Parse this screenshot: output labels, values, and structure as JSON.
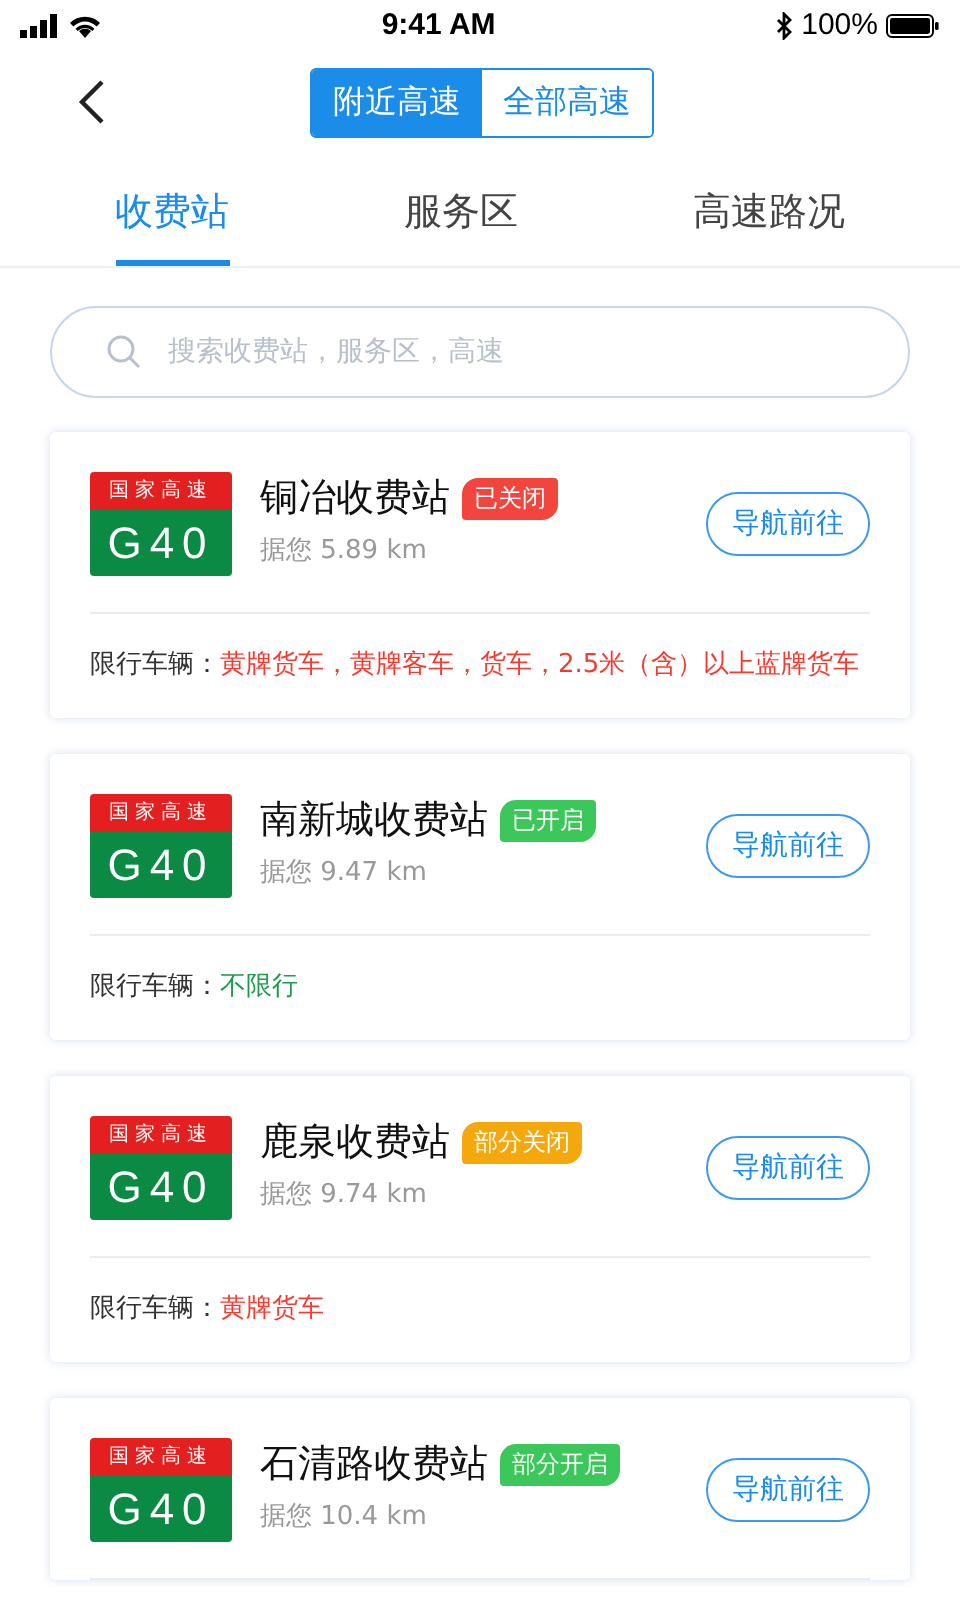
{
  "status_bar": {
    "time": "9:41 AM",
    "battery": "100%"
  },
  "segments": [
    {
      "label": "附近高速",
      "selected": true
    },
    {
      "label": "全部高速",
      "selected": false
    }
  ],
  "tabs": [
    {
      "label": "收费站",
      "selected": true
    },
    {
      "label": "服务区",
      "selected": false
    },
    {
      "label": "高速路况",
      "selected": false
    }
  ],
  "search": {
    "placeholder": "搜索收费站，服务区，高速"
  },
  "stations": [
    {
      "sign_top": "国家高速",
      "sign_code": "G40",
      "name": "铜冶收费站",
      "status": {
        "text": "已关闭",
        "color": "#f2453d"
      },
      "distance": "据您 5.89 km",
      "nav": "导航前往",
      "restriction": {
        "label": "限行车辆：",
        "text": "黄牌货车，黄牌客车，货车，2.5米（含）以上蓝牌货车",
        "color": "#f23c32"
      }
    },
    {
      "sign_top": "国家高速",
      "sign_code": "G40",
      "name": "南新城收费站",
      "status": {
        "text": "已开启",
        "color": "#3cc75a"
      },
      "distance": "据您 9.47 km",
      "nav": "导航前往",
      "restriction": {
        "label": "限行车辆：",
        "text": "不限行",
        "color": "#1f9a4e"
      }
    },
    {
      "sign_top": "国家高速",
      "sign_code": "G40",
      "name": "鹿泉收费站",
      "status": {
        "text": "部分关闭",
        "color": "#f5a80c"
      },
      "distance": "据您 9.74 km",
      "nav": "导航前往",
      "restriction": {
        "label": "限行车辆：",
        "text": "黄牌货车",
        "color": "#f23c32"
      }
    },
    {
      "sign_top": "国家高速",
      "sign_code": "G40",
      "name": "石清路收费站",
      "status": {
        "text": "部分开启",
        "color": "#3cc75a"
      },
      "distance": "据您 10.4 km",
      "nav": "导航前往"
    }
  ]
}
